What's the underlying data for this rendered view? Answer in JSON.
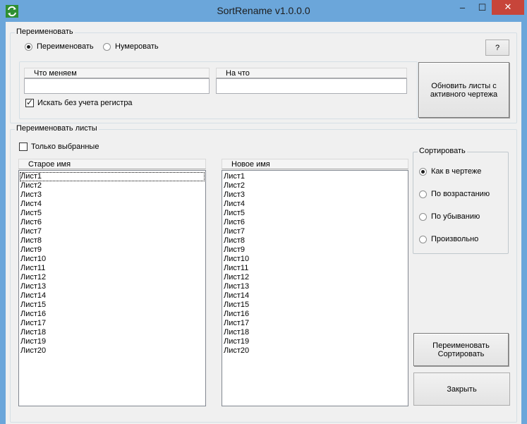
{
  "window": {
    "title": "SortRename v1.0.0.0"
  },
  "titlebar": {
    "minimize": "–",
    "maximize": "☐",
    "close": "✕"
  },
  "rename_group": {
    "legend": "Переименовать",
    "mode_rename": "Переименовать",
    "mode_number": "Нумеровать",
    "help_button": "?",
    "find_header": "Что меняем",
    "replace_header": "На что",
    "find_value": "",
    "replace_value": "",
    "case_insensitive": "Искать без учета регистра",
    "update_button": "Обновить листы с активного чертежа"
  },
  "sheets_group": {
    "legend": "Переименовать листы",
    "only_selected": "Только выбранные",
    "old_name_header": "Старое имя",
    "new_name_header": "Новое имя",
    "old_names": [
      "Лист1",
      "Лист2",
      "Лист3",
      "Лист4",
      "Лист5",
      "Лист6",
      "Лист7",
      "Лист8",
      "Лист9",
      "Лист10",
      "Лист11",
      "Лист12",
      "Лист13",
      "Лист14",
      "Лист15",
      "Лист16",
      "Лист17",
      "Лист18",
      "Лист19",
      "Лист20"
    ],
    "new_names": [
      "Лист1",
      "Лист2",
      "Лист3",
      "Лист4",
      "Лист5",
      "Лист6",
      "Лист7",
      "Лист8",
      "Лист9",
      "Лист10",
      "Лист11",
      "Лист12",
      "Лист13",
      "Лист14",
      "Лист15",
      "Лист16",
      "Лист17",
      "Лист18",
      "Лист19",
      "Лист20"
    ]
  },
  "sort_group": {
    "legend": "Сортировать",
    "as_in_drawing": "Как в чертеже",
    "ascending": "По возрастанию",
    "descending": "По убыванию",
    "arbitrary": "Произвольно"
  },
  "actions": {
    "rename_sort_line1": "Переименовать",
    "rename_sort_line2": "Сортировать",
    "close": "Закрыть"
  }
}
